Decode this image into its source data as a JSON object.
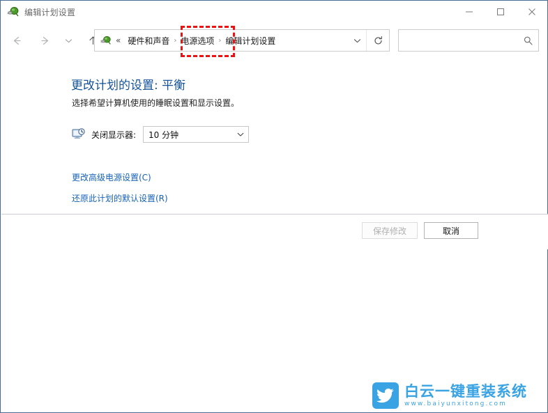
{
  "window": {
    "title": "编辑计划设置",
    "title_icon": "power-plug-icon",
    "controls": {
      "minimize": "minimize-icon",
      "maximize": "maximize-icon",
      "close": "close-icon"
    }
  },
  "navigation": {
    "back": "back-arrow-icon",
    "forward": "forward-arrow-icon",
    "recent": "chevron-down-icon",
    "up": "up-arrow-icon",
    "address": {
      "icon": "power-plug-icon",
      "overflow": "«",
      "separator": "›",
      "crumbs": [
        {
          "label": "硬件和声音",
          "highlighted": false
        },
        {
          "label": "电源选项",
          "highlighted": true
        },
        {
          "label": "编辑计划设置",
          "highlighted": false
        }
      ],
      "dropdown_icon": "chevron-down-icon",
      "refresh_icon": "refresh-icon"
    },
    "search": {
      "value": "",
      "placeholder": "",
      "icon": "search-icon"
    }
  },
  "annotation": {
    "target": "电源选项",
    "color": "#ee1111",
    "style": "dashed-rectangle"
  },
  "main": {
    "page_title": "更改计划的设置: 平衡",
    "page_title_color": "#14539a",
    "subtitle": "选择希望计算机使用的睡眠设置和显示设置。",
    "setting": {
      "icon": "monitor-clock-icon",
      "label": "关闭显示器:",
      "value": "10 分钟",
      "arrow_icon": "chevron-down-icon"
    },
    "links": [
      {
        "label": "更改高级电源设置(C)"
      },
      {
        "label": "还原此计划的默认设置(R)"
      }
    ],
    "link_color": "#1763b8"
  },
  "actions": {
    "save": {
      "label": "保存修改",
      "enabled": false
    },
    "cancel": {
      "label": "取消",
      "enabled": true
    }
  },
  "watermark": {
    "brand": "白云一键重装系统",
    "url": "www.baiyunxitong.com",
    "color": "#3aa3e3",
    "logo_icon": "bird-logo-icon"
  }
}
